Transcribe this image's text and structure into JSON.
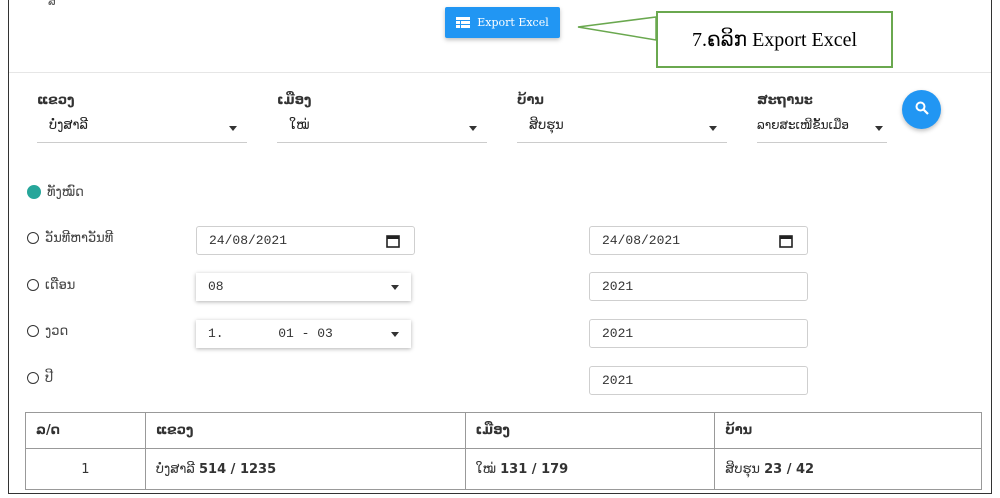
{
  "header": {
    "partial_text": "ສ",
    "export_button_label": "Export Excel",
    "callout_text": "7.ຄລິກ Export Excel"
  },
  "filters": {
    "province": {
      "label": "ແຂວງ",
      "value": "ບໍ່ງສາລີ"
    },
    "district": {
      "label": "ເມືອງ",
      "value": "ໃໝ່"
    },
    "village": {
      "label": "ບ້ານ",
      "value": "ສິບຮຸນ"
    },
    "status": {
      "label": "ສະຖານະ",
      "value": "ລາຍສະເໜີຂັ້ນເມືອ"
    }
  },
  "period": {
    "all": "ທັງໝົດ",
    "date_range": "ວັນທີຫາວັນທີ",
    "month": "ເດືອນ",
    "quarter": "ງວດ",
    "year": "ປີ",
    "date_from": "24/08/2021",
    "date_to": "24/08/2021",
    "month_value": "08",
    "month_year": "2021",
    "quarter_value": "1.       01 - 03",
    "quarter_year": "2021",
    "year_value": "2021"
  },
  "table": {
    "headers": [
      "ລ/ດ",
      "ແຂວງ",
      "ເມືອງ",
      "ບ້ານ"
    ],
    "rows": [
      {
        "no": "1",
        "province_name": "ບໍ່ງສາລີ",
        "province_count": "514 / 1235",
        "district_name": "ໃໝ່",
        "district_count": "131 / 179",
        "village_name": "ສິບຮຸນ",
        "village_count": "23 / 42"
      }
    ]
  },
  "colors": {
    "primary": "#2196f3",
    "radio_checked": "#26a69a",
    "callout_border": "#6aa84f"
  },
  "icons": {
    "export": "table-icon",
    "search": "search-icon",
    "calendar": "calendar-icon"
  }
}
